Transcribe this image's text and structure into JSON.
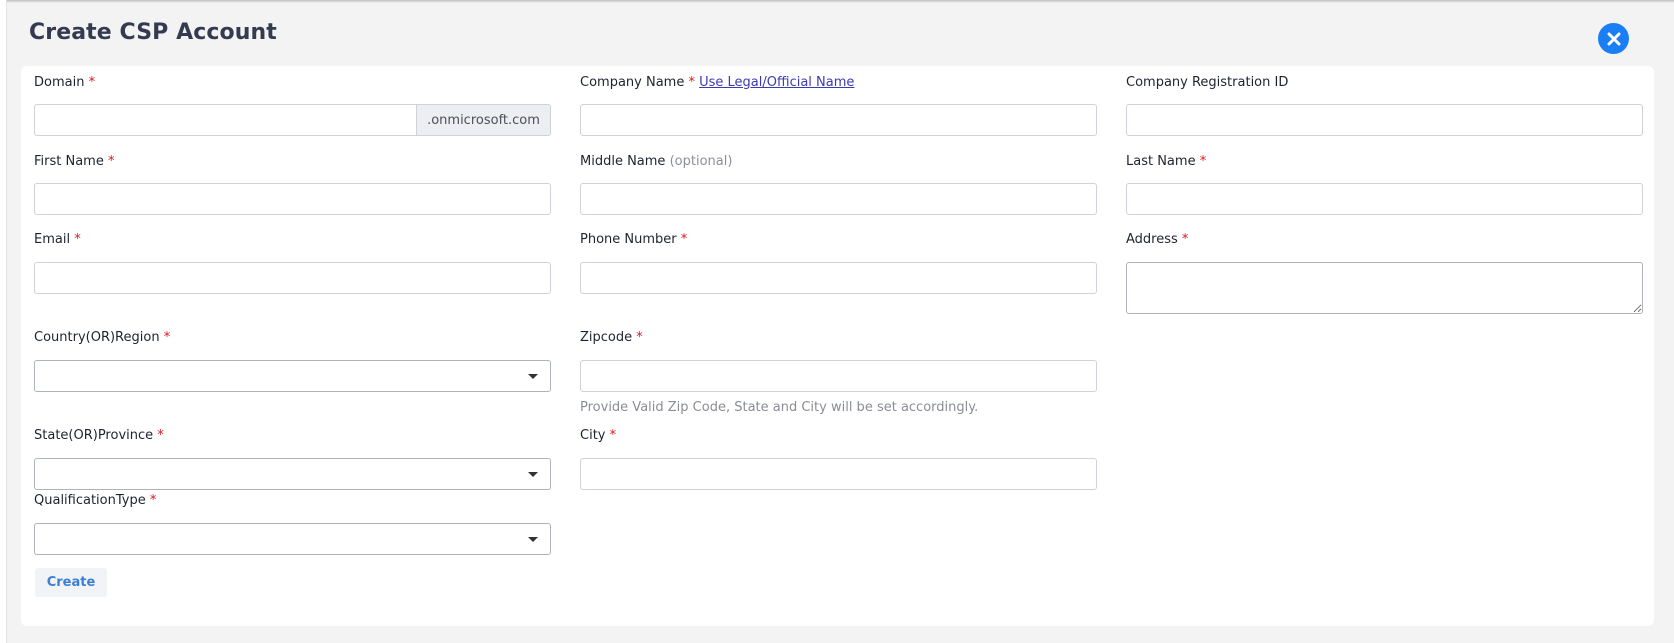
{
  "page": {
    "title": "Create CSP Account"
  },
  "icons": {
    "close": "close-circle-icon",
    "dropdown": "caret-down-icon"
  },
  "colors": {
    "accent": "#1a7ef5",
    "required": "#e0141e",
    "link": "#3b3bb3"
  },
  "form": {
    "required_marker": "*",
    "domain": {
      "label": "Domain",
      "value": "",
      "suffix": ".onmicrosoft.com"
    },
    "company_name": {
      "label": "Company Name",
      "link_text": "Use Legal/Official Name",
      "value": ""
    },
    "company_registration_id": {
      "label": "Company Registration ID",
      "value": ""
    },
    "first_name": {
      "label": "First Name",
      "value": ""
    },
    "middle_name": {
      "label": "Middle Name",
      "optional": "(optional)",
      "value": ""
    },
    "last_name": {
      "label": "Last Name",
      "value": ""
    },
    "email": {
      "label": "Email",
      "value": ""
    },
    "phone_number": {
      "label": "Phone Number",
      "value": ""
    },
    "address": {
      "label": "Address",
      "value": ""
    },
    "country": {
      "label": "Country(OR)Region",
      "value": ""
    },
    "zipcode": {
      "label": "Zipcode",
      "value": "",
      "helper": "Provide Valid Zip Code, State and City will be set accordingly."
    },
    "state": {
      "label": "State(OR)Province",
      "value": ""
    },
    "city": {
      "label": "City",
      "value": ""
    },
    "qualification_type": {
      "label": "QualificationType",
      "value": ""
    },
    "create_label": "Create"
  }
}
